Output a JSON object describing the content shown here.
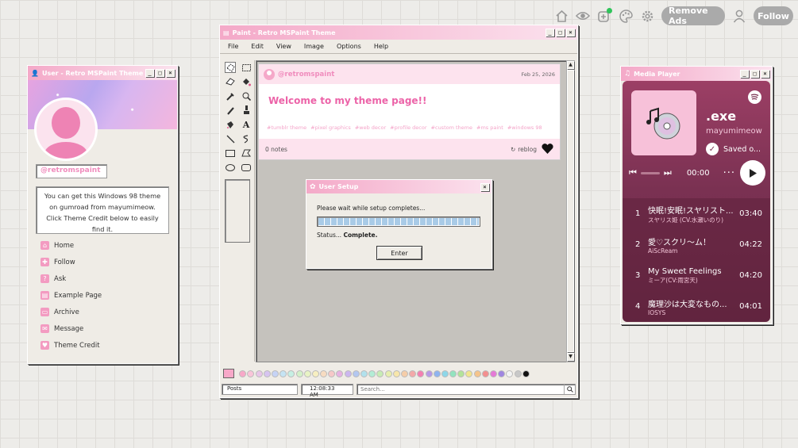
{
  "topnav": {
    "remove_ads": "Remove Ads",
    "follow": "Follow"
  },
  "user_window": {
    "title": "User - Retro MSPaint Theme",
    "username": "@retromspaint",
    "description": "You can get this Windows 98 theme on gumroad from mayumimeow. Click Theme Credit below to easily find it.",
    "nav": [
      {
        "label": "Home",
        "icon": "home-icon"
      },
      {
        "label": "Follow",
        "icon": "follow-icon"
      },
      {
        "label": "Ask",
        "icon": "ask-icon"
      },
      {
        "label": "Example Page",
        "icon": "page-icon"
      },
      {
        "label": "Archive",
        "icon": "archive-icon"
      },
      {
        "label": "Message",
        "icon": "mail-icon"
      },
      {
        "label": "Theme Credit",
        "icon": "heart-icon"
      }
    ]
  },
  "paint_window": {
    "title": "Paint - Retro MSPaint Theme",
    "menu": [
      "File",
      "Edit",
      "View",
      "Image",
      "Options",
      "Help"
    ],
    "post": {
      "username": "@retromspaint",
      "date": "Feb 25, 2026",
      "title": "Welcome to my theme page!!",
      "tags": [
        "#tumblr theme",
        "#pixel graphics",
        "#web decor",
        "#profile decor",
        "#custom theme",
        "#ms paint",
        "#windows 98"
      ],
      "notes": "0 notes",
      "reblog": "reblog"
    },
    "status": {
      "section": "Posts",
      "time": "12:08:33 AM",
      "search_placeholder": "Search..."
    },
    "palette": [
      "#f7a8c8",
      "#f9c5d9",
      "#e8c6e8",
      "#d7c4f0",
      "#c6d3f5",
      "#c5e3f3",
      "#c6efe3",
      "#d3f0c8",
      "#e8f3c4",
      "#f7efc1",
      "#f7dcc1",
      "#f6c8c8",
      "#e7b2e2",
      "#ccb6ef",
      "#b3c7f0",
      "#b2e1ec",
      "#b3ecd5",
      "#c7ecb4",
      "#e6eeae",
      "#f7e6aa",
      "#f5cda8",
      "#f3a9a9",
      "#f47fb1",
      "#b89ae6",
      "#8fb4ef",
      "#8ed7e8",
      "#93e3bf",
      "#b3e39a",
      "#f0e58f",
      "#f5c48b",
      "#f38f8f",
      "#e57ad6",
      "#9f86e0",
      "#f3f3f3",
      "#c8c8c8",
      "#111111"
    ]
  },
  "setup_dialog": {
    "title": "User Setup",
    "message": "Please wait while setup completes...",
    "status_label": "Status...",
    "status_value": "Complete.",
    "enter": "Enter",
    "progress": 1.0
  },
  "media_player": {
    "title": "Media Player",
    "album": ".exe",
    "artist": "mayumimeow",
    "saved": "Saved o...",
    "time": "00:00",
    "tracks": [
      {
        "num": "1",
        "title": "快眠!安眠!スヤリスト...",
        "artist": "スヤリス姫 (CV.水瀬いのり)",
        "duration": "03:40"
      },
      {
        "num": "2",
        "title": "愛♡スクリ〜ム！",
        "artist": "AiScReam",
        "duration": "04:22"
      },
      {
        "num": "3",
        "title": "My Sweet Feelings",
        "artist": "ミーア(CV:雨宮天)",
        "duration": "04:20"
      },
      {
        "num": "4",
        "title": "魔理沙は大変なもの...",
        "artist": "IOSYS",
        "duration": "04:01"
      }
    ]
  }
}
